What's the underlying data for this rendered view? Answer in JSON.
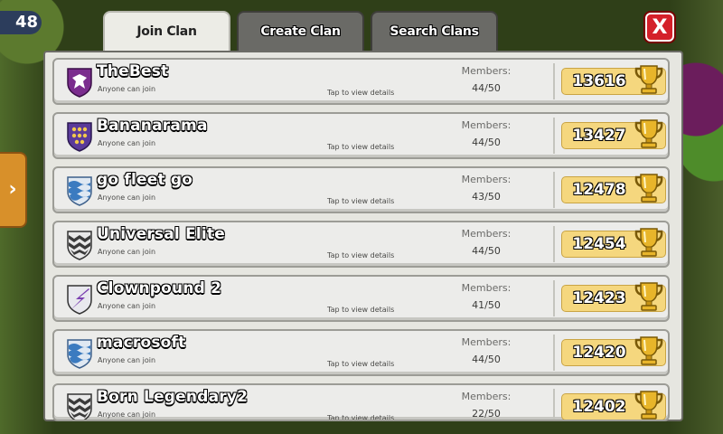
{
  "hud": {
    "gem_count": "48"
  },
  "tabs": [
    {
      "label": "Join Clan",
      "active": true
    },
    {
      "label": "Create Clan",
      "active": false
    },
    {
      "label": "Search Clans",
      "active": false
    }
  ],
  "close_label": "X",
  "labels": {
    "members": "Members:",
    "tap": "Tap to view details"
  },
  "colors": {
    "accent_gold": "#f5d77e",
    "close_red": "#d4202a",
    "name_white": "#ffffff"
  },
  "clans": [
    {
      "name": "TheBest",
      "status": "Anyone can join",
      "members": "44/50",
      "trophies": "13616",
      "badge": "eagle-badge-icon"
    },
    {
      "name": "Bananarama",
      "status": "Anyone can join",
      "members": "44/50",
      "trophies": "13427",
      "badge": "star-shield-badge-icon"
    },
    {
      "name": "go fleet go",
      "status": "Anyone can join",
      "members": "43/50",
      "trophies": "12478",
      "badge": "wave-shield-badge-icon"
    },
    {
      "name": "Universal Elite",
      "status": "Anyone can join",
      "members": "44/50",
      "trophies": "12454",
      "badge": "chevron-shield-badge-icon"
    },
    {
      "name": "Clownpound 2",
      "status": "Anyone can join",
      "members": "41/50",
      "trophies": "12423",
      "badge": "lightning-shield-badge-icon"
    },
    {
      "name": "macrosoft",
      "status": "Anyone can join",
      "members": "44/50",
      "trophies": "12420",
      "badge": "wave-shield-badge-icon"
    },
    {
      "name": "Born Legendary2",
      "status": "Anyone can join",
      "members": "22/50",
      "trophies": "12402",
      "badge": "chevron-shield-badge-icon"
    }
  ]
}
